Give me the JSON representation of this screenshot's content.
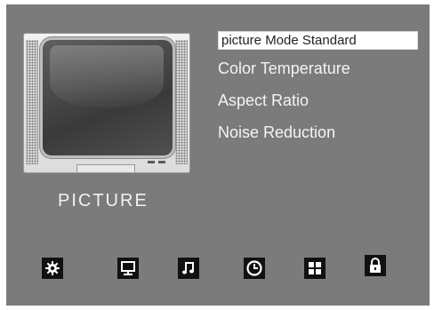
{
  "title": "PICTURE",
  "menu": {
    "items": [
      {
        "label": "picture Mode Standard",
        "selected": true
      },
      {
        "label": "Color Temperature",
        "selected": false
      },
      {
        "label": "Aspect Ratio",
        "selected": false
      },
      {
        "label": "Noise Reduction",
        "selected": false
      }
    ]
  },
  "bottom_icons": [
    "gear-icon",
    "monitor-icon",
    "music-icon",
    "clock-icon",
    "grid-icon",
    "lock-icon"
  ],
  "colors": {
    "background": "#7b7b7b",
    "text": "#f4f4f4",
    "highlight": "#ffffff",
    "icon": "#111111"
  }
}
